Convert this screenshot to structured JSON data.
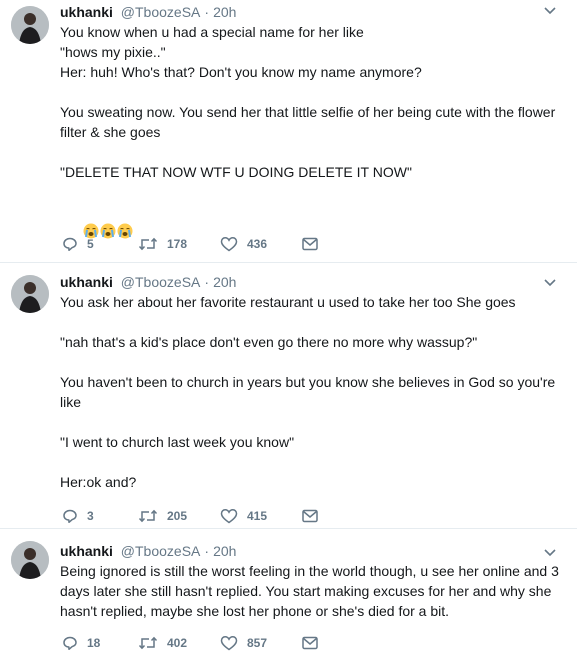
{
  "tweets": [
    {
      "name": "ukhanki",
      "handle": "@TboozeSA",
      "time": "20h",
      "lines": [
        "You know when u had a special name for her like",
        "\"hows my pixie..\"",
        "Her: huh! Who's that? Don't you know my name anymore?",
        "",
        "You sweating now. You send her that little selfie of her being cute with the flower filter & she goes",
        "",
        "\"DELETE THAT NOW WTF U DOING DELETE IT NOW\""
      ],
      "emoji": [
        "loudly-crying-face",
        "loudly-crying-face",
        "loudly-crying-face"
      ],
      "replies": "5",
      "retweets": "178",
      "likes": "436"
    },
    {
      "name": "ukhanki",
      "handle": "@TboozeSA",
      "time": "20h",
      "lines": [
        "You ask her about her favorite restaurant u used to take her too She goes",
        "",
        "\"nah that's a kid's place don't even go there no more why wassup?\"",
        "",
        "You haven't been to church in years but you know she believes in God so you're like",
        "",
        "\"I went to church last week you know\"",
        "",
        "Her:ok and?"
      ],
      "replies": "3",
      "retweets": "205",
      "likes": "415"
    },
    {
      "name": "ukhanki",
      "handle": "@TboozeSA",
      "time": "20h",
      "lines": [
        "Being ignored is still the worst feeling in the world though, u see her online and 3 days later she still hasn't replied. You start making excuses for her and why she hasn't replied, maybe she lost her phone or she's died for a bit."
      ],
      "replies": "18",
      "retweets": "402",
      "likes": "857"
    }
  ],
  "colors": {
    "text": "#14171a",
    "meta": "#657786",
    "divider": "#e6ecf0"
  }
}
